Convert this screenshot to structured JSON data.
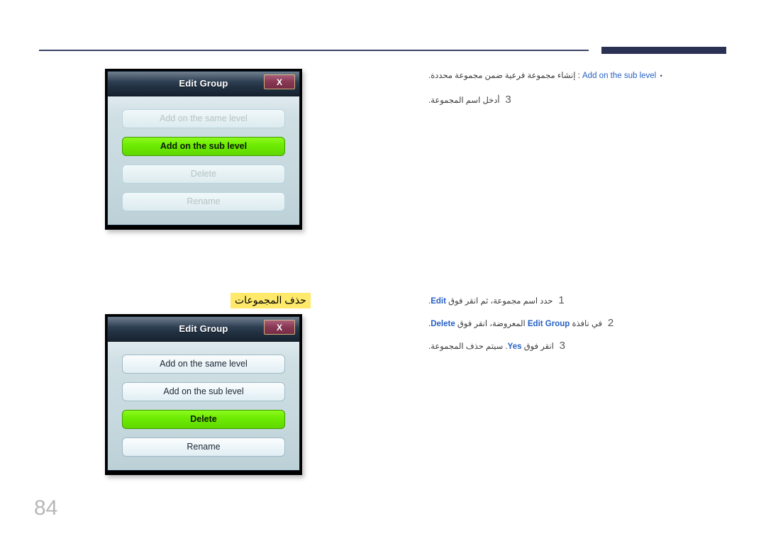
{
  "page": {
    "number": "84",
    "section_heading": "حذف المجموعات"
  },
  "dialog_one": {
    "title": "Edit Group",
    "close_label": "X",
    "buttons": [
      {
        "label": "Add on the same level",
        "state": "disabled"
      },
      {
        "label": "Add on the sub level",
        "state": "selected"
      },
      {
        "label": "Delete",
        "state": "disabled"
      },
      {
        "label": "Rename",
        "state": "disabled"
      }
    ]
  },
  "dialog_two": {
    "title": "Edit Group",
    "close_label": "X",
    "buttons": [
      {
        "label": "Add on the same level",
        "state": "normal"
      },
      {
        "label": "Add on the sub level",
        "state": "normal"
      },
      {
        "label": "Delete",
        "state": "selected"
      },
      {
        "label": "Rename",
        "state": "normal"
      }
    ]
  },
  "instructions_top": {
    "bullet": {
      "marker": "•",
      "keyword": "Add on the sub level",
      "separator": " :",
      "text": "إنشاء مجموعة فرعية ضمن مجموعة محددة."
    },
    "step": {
      "number": "3",
      "text": "أدخل اسم المجموعة."
    }
  },
  "instructions_bottom": {
    "steps": [
      {
        "number": "1",
        "prefix": "حدد اسم مجموعة، ثم انقر فوق ",
        "keyword": "Edit",
        "suffix": "."
      },
      {
        "number": "2",
        "prefix": "في نافذة ",
        "keyword": "Edit Group",
        "middle": " المعروضة، انقر فوق ",
        "keyword2": "Delete",
        "suffix": "."
      },
      {
        "number": "3",
        "prefix": "انقر فوق ",
        "keyword": "Yes",
        "suffix": ". سيتم حذف المجموعة."
      }
    ]
  }
}
